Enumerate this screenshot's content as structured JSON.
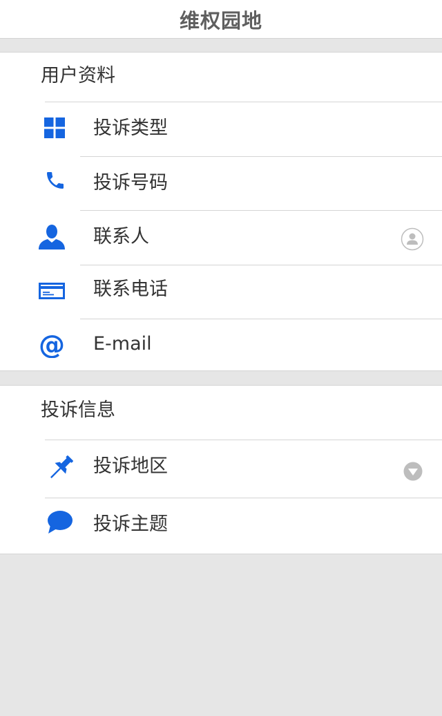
{
  "header": {
    "title": "维权园地"
  },
  "sections": [
    {
      "title": "用户资料",
      "items": [
        {
          "label": "投诉类型",
          "icon": "grid-icon"
        },
        {
          "label": "投诉号码",
          "icon": "phone-icon"
        },
        {
          "label": "联系人",
          "icon": "person-icon",
          "right_icon": "contact-picker-icon"
        },
        {
          "label": "联系电话",
          "icon": "card-icon"
        },
        {
          "label": "E-mail",
          "icon": "at-icon"
        }
      ]
    },
    {
      "title": "投诉信息",
      "items": [
        {
          "label": "投诉地区",
          "icon": "pin-icon",
          "right_icon": "dropdown-arrow-icon"
        },
        {
          "label": "投诉主题",
          "icon": "chat-bubble-icon"
        }
      ]
    }
  ],
  "colors": {
    "accent": "#1565e0",
    "background": "#e6e6e6",
    "text": "#333333",
    "header_text": "#5f5f5f",
    "divider": "#d4d4d4",
    "secondary_icon": "#bdbdbd"
  }
}
